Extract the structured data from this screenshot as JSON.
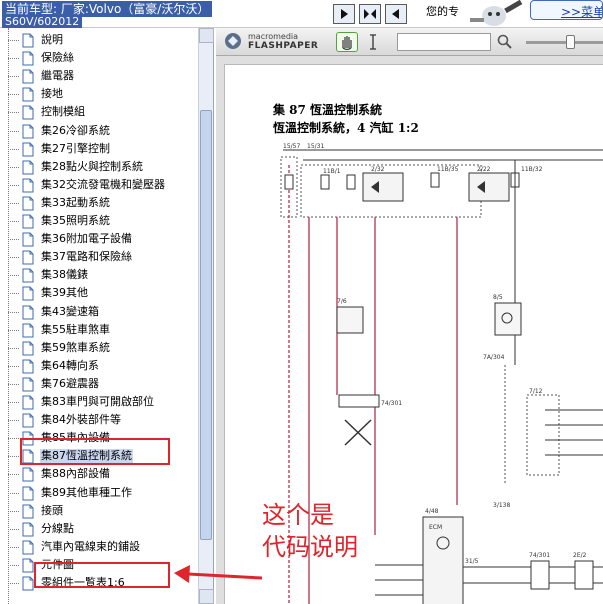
{
  "header": {
    "car_model_label": "当前车型:  厂家:Volvo（富豪/沃尔沃）",
    "car_model_line2": "S60V/602012",
    "welcome_text": "您的专",
    "menu_link": ">>菜单"
  },
  "sidebar": {
    "items": [
      {
        "label": "說明"
      },
      {
        "label": "保險絲"
      },
      {
        "label": "繼電器"
      },
      {
        "label": "接地"
      },
      {
        "label": "控制模組"
      },
      {
        "label": "集26冷卻系統"
      },
      {
        "label": "集27引擎控制"
      },
      {
        "label": "集28點火與控制系統"
      },
      {
        "label": "集32交流發電機和變壓器"
      },
      {
        "label": "集33起動系統"
      },
      {
        "label": "集35照明系統"
      },
      {
        "label": "集36附加電子設備"
      },
      {
        "label": "集37電路和保險絲"
      },
      {
        "label": "集38儀錶"
      },
      {
        "label": "集39其他"
      },
      {
        "label": "集43變速箱"
      },
      {
        "label": "集55駐車煞車"
      },
      {
        "label": "集59煞車系統"
      },
      {
        "label": "集64轉向系"
      },
      {
        "label": "集76避震器"
      },
      {
        "label": "集83車門與可開啟部位"
      },
      {
        "label": "集84外裝部件等"
      },
      {
        "label": "集85車內設備"
      },
      {
        "label": "集87恆溫控制系統",
        "selected": true
      },
      {
        "label": "集88內部設備"
      },
      {
        "label": "集89其他車種工作"
      },
      {
        "label": "接頭"
      },
      {
        "label": "分線點"
      },
      {
        "label": "汽車內電線束的鋪設"
      },
      {
        "label": "元件圖"
      },
      {
        "label": "零組件一覧表1:6"
      }
    ]
  },
  "viewer": {
    "brand_small": "macromedia",
    "brand_large": "FLASHPAPER",
    "search_value": "",
    "doc_title_line1": "集 87 恆溫控制系統",
    "doc_title_line2": "恆溫控制系統，4 汽缸 1:2",
    "schematic_labels": [
      "15/57",
      "15/31",
      "11B/1",
      "2/32",
      "11B/35",
      "2/22",
      "11B/32",
      "7/6",
      "8/5",
      "7A/304",
      "74/301",
      "7/12",
      "3/138",
      "4/48",
      "ECM",
      "74/301",
      "31/5",
      "2E/2"
    ]
  },
  "annotation": {
    "line1": "这个是",
    "line2": "代码说明"
  },
  "colors": {
    "annotation_red": "#e0242b",
    "selection_bg": "#c9d7f0",
    "car_label_bg": "#3a5fa8",
    "wire_red": "#b0203a"
  }
}
